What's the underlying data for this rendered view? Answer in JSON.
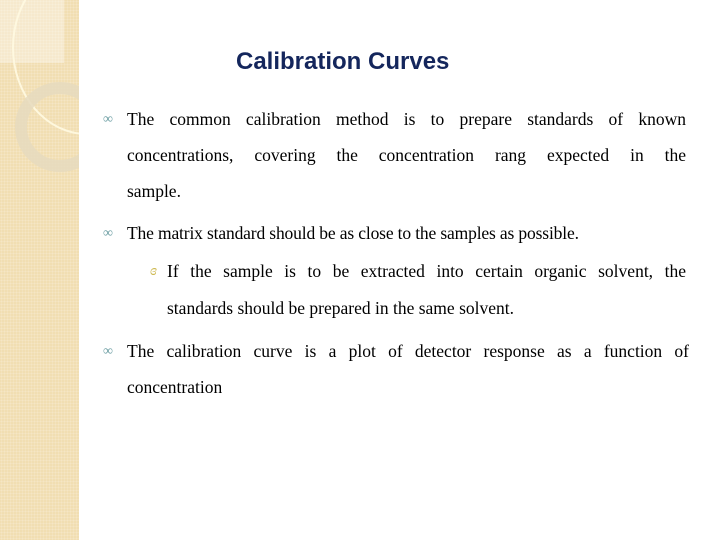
{
  "slide": {
    "title": "Calibration Curves",
    "bullet_icon": "curly-bullet-icon",
    "sub_bullet_icon": "script-bullet-icon",
    "bullets": [
      {
        "lines": [
          "The common calibration method is to prepare standards of known",
          "concentrations, covering the concentration rang expected in the",
          "sample."
        ]
      },
      {
        "lines": [
          "The matrix standard should be as close to the samples as possible."
        ],
        "sub_bullets": [
          {
            "lines": [
              "If the sample is to be extracted into certain organic solvent, the",
              "standards should be prepared in the same solvent."
            ]
          }
        ]
      },
      {
        "lines": [
          "The calibration curve is a plot of detector response as a function of",
          "concentration"
        ]
      }
    ]
  },
  "glyphs": {
    "bullet": "∞",
    "sub_bullet": "ɞ"
  }
}
